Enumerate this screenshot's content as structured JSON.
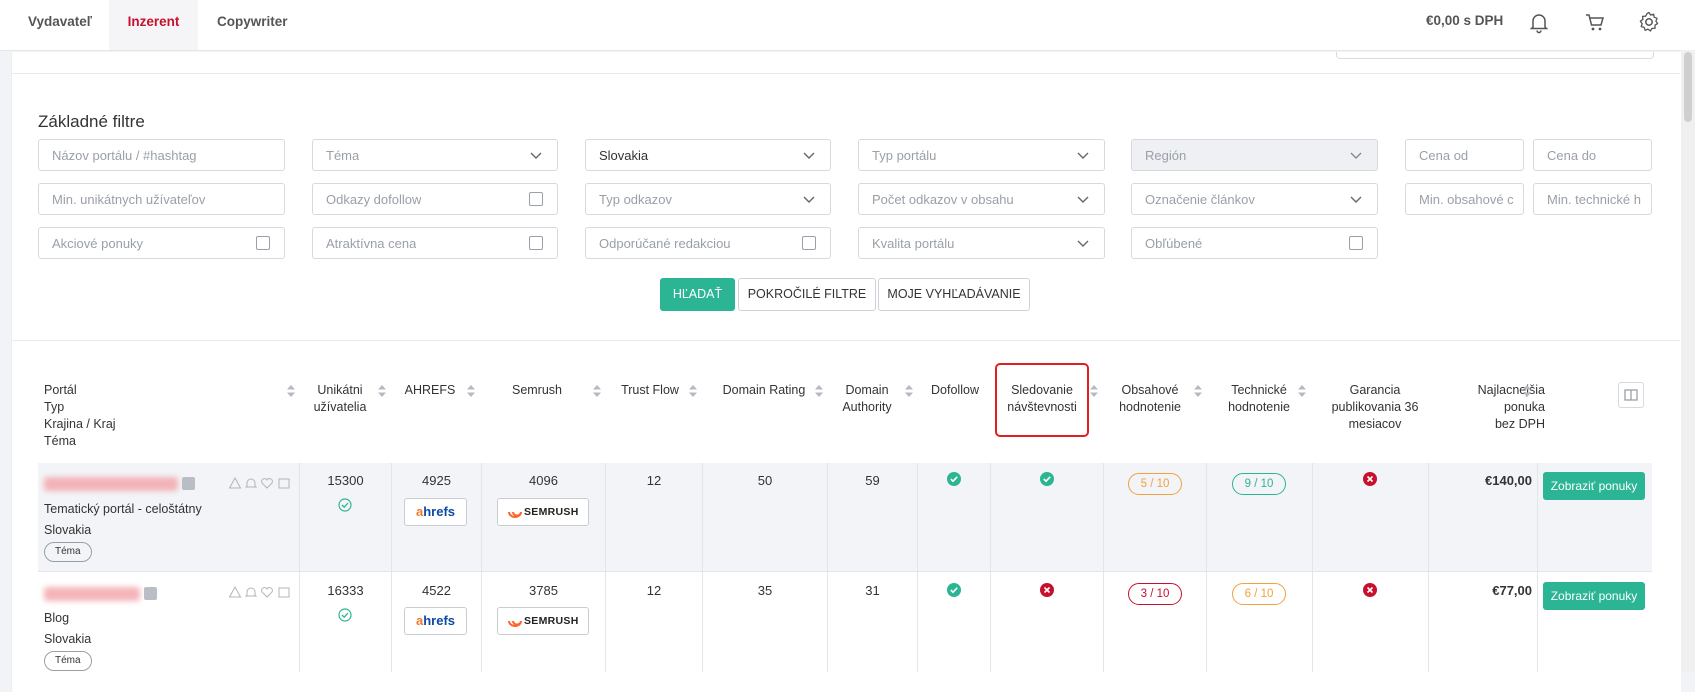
{
  "nav": {
    "tabs": [
      "Vydavateľ",
      "Inzerent",
      "Copywriter"
    ],
    "active_tab": "Inzerent",
    "balance": "€0,00 s DPH",
    "icons": [
      "bell-icon",
      "cart-icon",
      "gear-icon"
    ]
  },
  "filters": {
    "title": "Základné filtre",
    "row1": {
      "name_placeholder": "Názov portálu / #hashtag",
      "topic_placeholder": "Téma",
      "country_value": "Slovakia",
      "portal_type_placeholder": "Typ portálu",
      "region_placeholder": "Región",
      "price_from_placeholder": "Cena od",
      "price_to_placeholder": "Cena do"
    },
    "row2": {
      "min_users_placeholder": "Min. unikátnych užívateľov",
      "dofollow_label": "Odkazy dofollow",
      "link_type_placeholder": "Typ odkazov",
      "links_count_placeholder": "Počet odkazov v obsahu",
      "article_mark_placeholder": "Označenie článkov",
      "min_content_placeholder": "Min. obsahové c",
      "min_tech_placeholder": "Min. technické h"
    },
    "row3": {
      "promo_label": "Akciové ponuky",
      "attractive_label": "Atraktívna cena",
      "recommended_label": "Odporúčané redakciou",
      "quality_placeholder": "Kvalita portálu",
      "favorite_label": "Obľúbené"
    },
    "buttons": {
      "search": "HĽADAŤ",
      "advanced": "POKROČILÉ FILTRE",
      "my_searches": "MOJE VYHĽADÁVANIE"
    }
  },
  "table": {
    "headers": {
      "portal": [
        "Portál",
        "Typ",
        "Krajina / Kraj",
        "Téma"
      ],
      "unique_users": [
        "Unikátni",
        "užívatelia"
      ],
      "ahrefs": [
        "AHREFS"
      ],
      "semrush": [
        "Semrush"
      ],
      "trust_flow": [
        "Trust Flow"
      ],
      "domain_rating": [
        "Domain Rating"
      ],
      "domain_authority": [
        "Domain",
        "Authority"
      ],
      "dofollow": [
        "Dofollow"
      ],
      "traffic_tracking": [
        "Sledovanie",
        "návštevnosti"
      ],
      "content_rating": [
        "Obsahové",
        "hodnotenie"
      ],
      "tech_rating": [
        "Technické",
        "hodnotenie"
      ],
      "guarantee": [
        "Garancia",
        "publikovania 36",
        "mesiacov"
      ],
      "cheapest": [
        "Najlacnejšia",
        "ponuka",
        "bez DPH"
      ]
    },
    "ahrefs_logo": {
      "a": "a",
      "rest": "hrefs"
    },
    "semrush_logo": "SEMRUSH",
    "rows": [
      {
        "type": "Tematický portál - celoštátny",
        "country": "Slovakia",
        "tag": "Téma",
        "unique_users": "15300",
        "ahrefs": "4925",
        "semrush": "4096",
        "trust_flow": "12",
        "domain_rating": "50",
        "domain_authority": "59",
        "dofollow": "yes",
        "traffic_tracking": "yes",
        "content_rating": "5 / 10",
        "tech_rating": "9 / 10",
        "guarantee": "no",
        "price": "€140,00",
        "offer_button": "Zobraziť ponuky"
      },
      {
        "type": "Blog",
        "country": "Slovakia",
        "tag": "Téma",
        "unique_users": "16333",
        "ahrefs": "4522",
        "semrush": "3785",
        "trust_flow": "12",
        "domain_rating": "35",
        "domain_authority": "31",
        "dofollow": "yes",
        "traffic_tracking": "no",
        "content_rating": "3 / 10",
        "tech_rating": "6 / 10",
        "guarantee": "no",
        "price": "€77,00",
        "offer_button": "Zobraziť ponuky"
      }
    ]
  },
  "colors": {
    "accent": "#2bb594",
    "brand_red": "#c8102e",
    "orange": "#f0a33a"
  }
}
